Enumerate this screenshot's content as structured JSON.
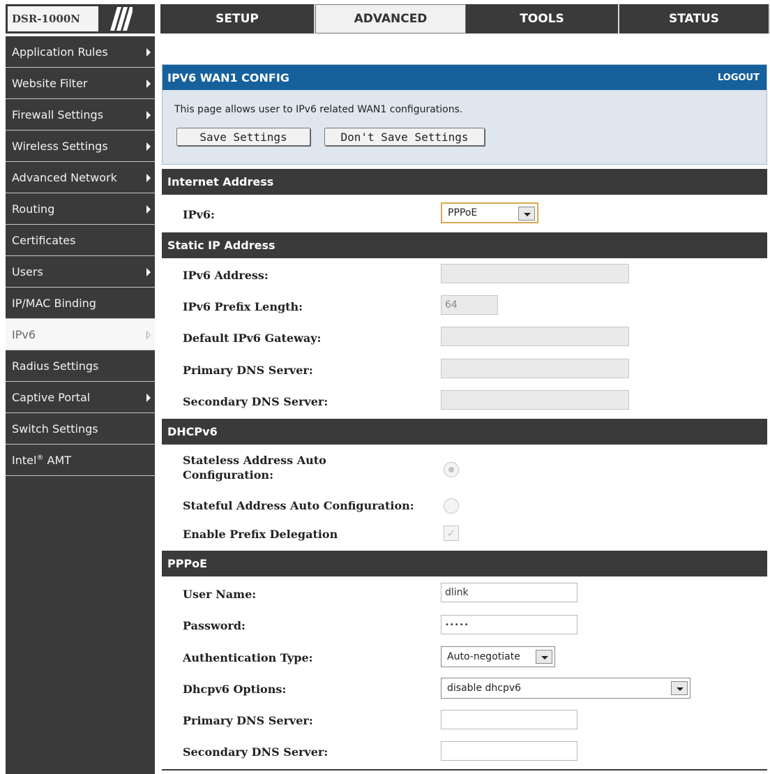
{
  "brand": {
    "model": "DSR-1000N"
  },
  "tabs": [
    {
      "label": "SETUP",
      "active": false
    },
    {
      "label": "ADVANCED",
      "active": true
    },
    {
      "label": "TOOLS",
      "active": false
    },
    {
      "label": "STATUS",
      "active": false
    }
  ],
  "sidebar": {
    "items": [
      {
        "label": "Application Rules",
        "arrow": true
      },
      {
        "label": "Website Filter",
        "arrow": true
      },
      {
        "label": "Firewall Settings",
        "arrow": true
      },
      {
        "label": "Wireless Settings",
        "arrow": true
      },
      {
        "label": "Advanced Network",
        "arrow": true
      },
      {
        "label": "Routing",
        "arrow": true
      },
      {
        "label": "Certificates",
        "arrow": false
      },
      {
        "label": "Users",
        "arrow": true
      },
      {
        "label": "IP/MAC Binding",
        "arrow": false
      },
      {
        "label": "IPv6",
        "arrow": true,
        "active": true
      },
      {
        "label": "Radius Settings",
        "arrow": false
      },
      {
        "label": "Captive Portal",
        "arrow": true
      },
      {
        "label": "Switch Settings",
        "arrow": false
      },
      {
        "label": "Intel",
        "sup": "®",
        "suffix": " AMT",
        "arrow": false
      }
    ]
  },
  "config": {
    "title": "IPV6 WAN1 CONFIG",
    "logout": "LOGOUT",
    "description": "This page allows user to IPv6 related WAN1 configurations.",
    "save_label": "Save Settings",
    "nosave_label": "Don't Save Settings"
  },
  "internet_address": {
    "heading": "Internet Address",
    "ipv6_label": "IPv6:",
    "ipv6_value": "PPPoE"
  },
  "static_ip": {
    "heading": "Static IP Address",
    "address_label": "IPv6 Address:",
    "address_value": "",
    "prefix_label": "IPv6 Prefix Length:",
    "prefix_value": "64",
    "gateway_label": "Default IPv6 Gateway:",
    "gateway_value": "",
    "primary_dns_label": "Primary DNS Server:",
    "primary_dns_value": "",
    "secondary_dns_label": "Secondary DNS Server:",
    "secondary_dns_value": ""
  },
  "dhcpv6": {
    "heading": "DHCPv6",
    "stateless_label_line1": "Stateless Address Auto",
    "stateless_label_line2": "Configuration:",
    "stateless_checked": true,
    "stateful_label": "Stateful Address Auto Configuration:",
    "stateful_checked": false,
    "prefix_delegation_label": "Enable Prefix Delegation",
    "prefix_delegation_checked": true
  },
  "pppoe": {
    "heading": "PPPoE",
    "username_label": "User Name:",
    "username_value": "dlink",
    "password_label": "Password:",
    "password_value": "•••••",
    "auth_label": "Authentication Type:",
    "auth_value": "Auto-negotiate",
    "dhcpv6_options_label": "Dhcpv6 Options:",
    "dhcpv6_options_value": "disable dhcpv6",
    "primary_dns_label": "Primary DNS Server:",
    "primary_dns_value": "",
    "secondary_dns_label": "Secondary DNS Server:",
    "secondary_dns_value": ""
  }
}
